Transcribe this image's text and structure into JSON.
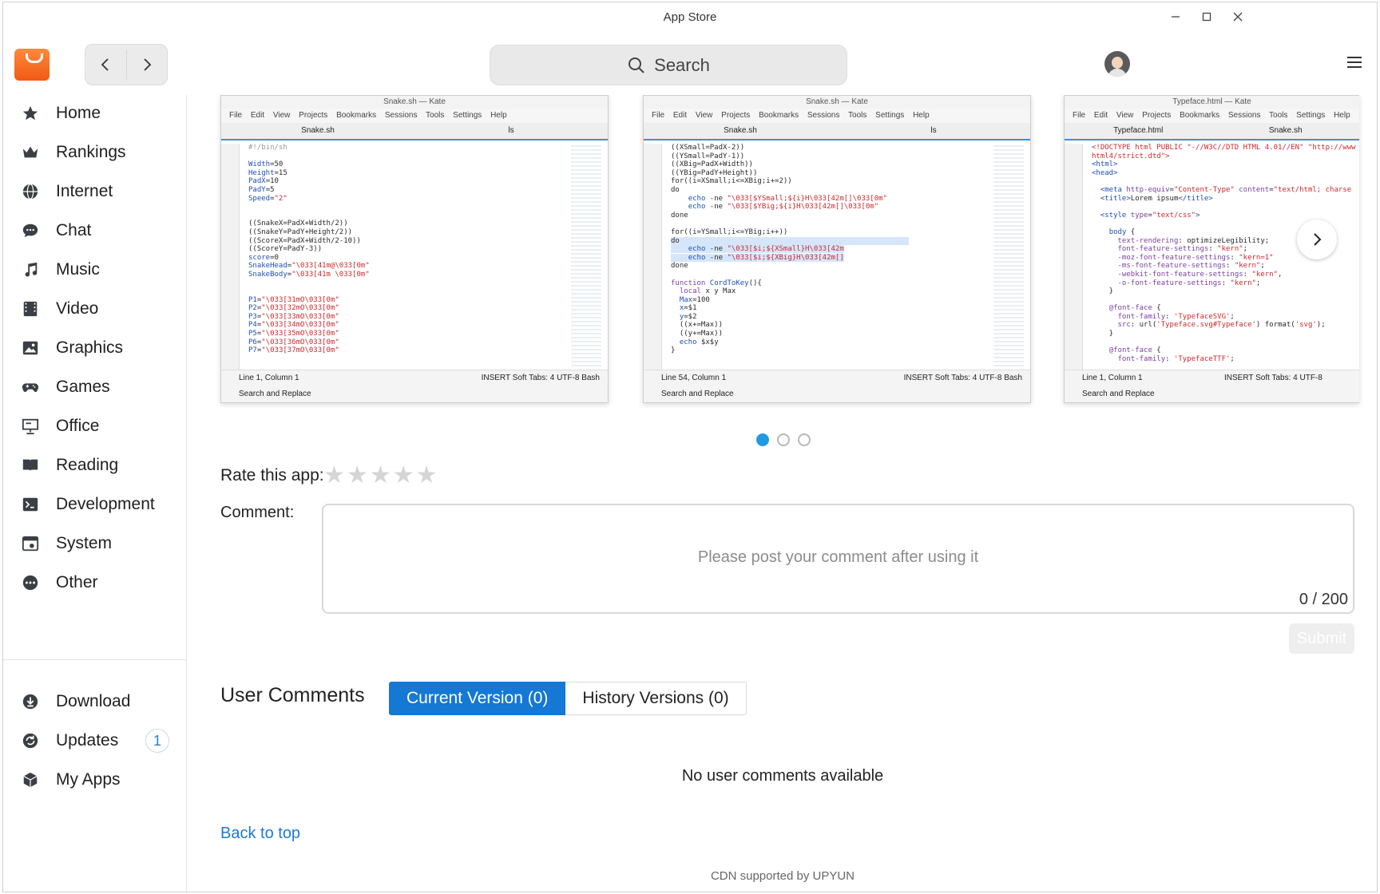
{
  "window": {
    "title": "App Store"
  },
  "header": {
    "search_placeholder": "Search"
  },
  "sidebar": {
    "items": [
      {
        "label": "Home",
        "icon": "star-icon"
      },
      {
        "label": "Rankings",
        "icon": "crown-icon"
      },
      {
        "label": "Internet",
        "icon": "globe-icon"
      },
      {
        "label": "Chat",
        "icon": "chat-bubble-icon"
      },
      {
        "label": "Music",
        "icon": "music-note-icon"
      },
      {
        "label": "Video",
        "icon": "film-icon"
      },
      {
        "label": "Graphics",
        "icon": "image-icon"
      },
      {
        "label": "Games",
        "icon": "gamepad-icon"
      },
      {
        "label": "Office",
        "icon": "presentation-icon"
      },
      {
        "label": "Reading",
        "icon": "book-icon"
      },
      {
        "label": "Development",
        "icon": "terminal-icon"
      },
      {
        "label": "System",
        "icon": "system-window-icon"
      },
      {
        "label": "Other",
        "icon": "more-dots-icon"
      }
    ],
    "bottom_items": [
      {
        "label": "Download",
        "icon": "download-icon"
      },
      {
        "label": "Updates",
        "icon": "refresh-icon",
        "badge": "1"
      },
      {
        "label": "My Apps",
        "icon": "box-icon"
      }
    ]
  },
  "screenshots": [
    {
      "title": "Snake.sh — Kate",
      "menu": "File Edit View Projects Bookmarks Sessions Tools Settings Help",
      "tabs": [
        "Snake.sh",
        "ls"
      ],
      "status": "Line 1, Column 1",
      "status_right": "INSERT   Soft Tabs: 4   UTF-8   Bash",
      "find": "Search and Replace"
    },
    {
      "title": "Snake.sh — Kate",
      "menu": "File Edit View Projects Bookmarks Sessions Tools Settings Help",
      "tabs": [
        "Snake.sh",
        "ls"
      ],
      "status": "Line 54, Column 1",
      "status_right": "INSERT   Soft Tabs: 4   UTF-8   Bash",
      "find": "Search and Replace"
    },
    {
      "title": "Typeface.html — Kate",
      "menu": "File Edit View Projects Bookmarks Sessions Tools Settings Help",
      "tabs": [
        "Typeface.html",
        "Snake.sh"
      ],
      "status": "Line 1, Column 1",
      "status_right": "INSERT   Soft Tabs: 4   UTF-8",
      "find": "Search and Replace"
    }
  ],
  "carousel": {
    "pages": 3,
    "active_page": 1
  },
  "rating": {
    "label": "Rate this app:",
    "max_stars": 5,
    "value": 0
  },
  "comment": {
    "label": "Comment:",
    "placeholder": "Please post your comment after using it",
    "counter": "0 / 200",
    "submit_label": "Submit"
  },
  "user_comments": {
    "title": "User Comments",
    "tabs": [
      "Current Version (0)",
      "History Versions (0)"
    ],
    "empty_text": "No user comments available"
  },
  "footer": {
    "back_to_top": "Back to top",
    "cdn": "CDN supported by UPYUN"
  },
  "colors": {
    "accent": "#1478d4",
    "dot_active": "#1f9ae3",
    "link": "#1d7ad0"
  }
}
